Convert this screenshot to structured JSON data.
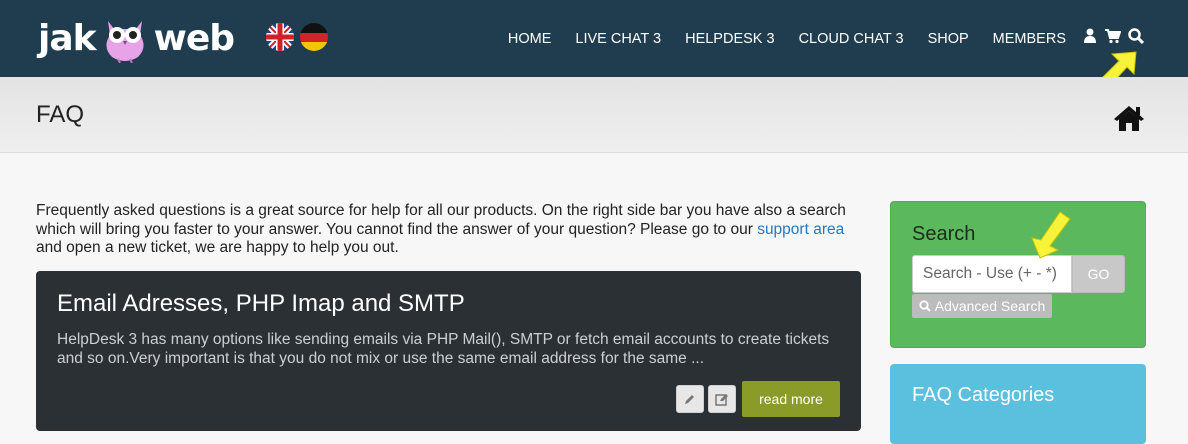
{
  "brand": {
    "logo_left": "jak",
    "logo_right": "web"
  },
  "languages": [
    {
      "name": "English"
    },
    {
      "name": "German"
    }
  ],
  "nav": {
    "links": [
      "HOME",
      "LIVE CHAT 3",
      "HELPDESK 3",
      "CLOUD CHAT 3",
      "SHOP",
      "MEMBERS"
    ],
    "icons": [
      "user-icon",
      "cart-icon",
      "search-icon"
    ]
  },
  "header": {
    "title": "FAQ",
    "home_icon": "home-icon"
  },
  "intro": {
    "text_before_link": "Frequently asked questions is a great source for help for all our products. On the right side bar you have also a search which will bring you faster to your answer. You cannot find the answer of your question? Please go to our ",
    "link_text": "support area",
    "text_after_link": " and open a new ticket, we are happy to help you out."
  },
  "faq_item": {
    "title": "Email Adresses, PHP Imap and SMTP",
    "excerpt": "HelpDesk 3 has many options like sending emails via PHP Mail(), SMTP or fetch email accounts to create tickets and so on.Very important is that you do not mix or use the same email address for the same ...",
    "read_more_label": "read more",
    "edit_icon": "pencil-icon",
    "edit_box_icon": "edit-box-icon"
  },
  "search": {
    "title": "Search",
    "placeholder": "Search - Use (+ - *)",
    "go_label": "GO",
    "advanced_label": "Advanced Search"
  },
  "categories": {
    "title": "FAQ Categories"
  },
  "colors": {
    "navbar": "#1f3d4e",
    "search_panel": "#5cb85c",
    "categories_panel": "#5bc0de",
    "read_more": "#8a9b27",
    "link": "#1f7ac6",
    "highlight_arrow": "#f7f23a"
  }
}
